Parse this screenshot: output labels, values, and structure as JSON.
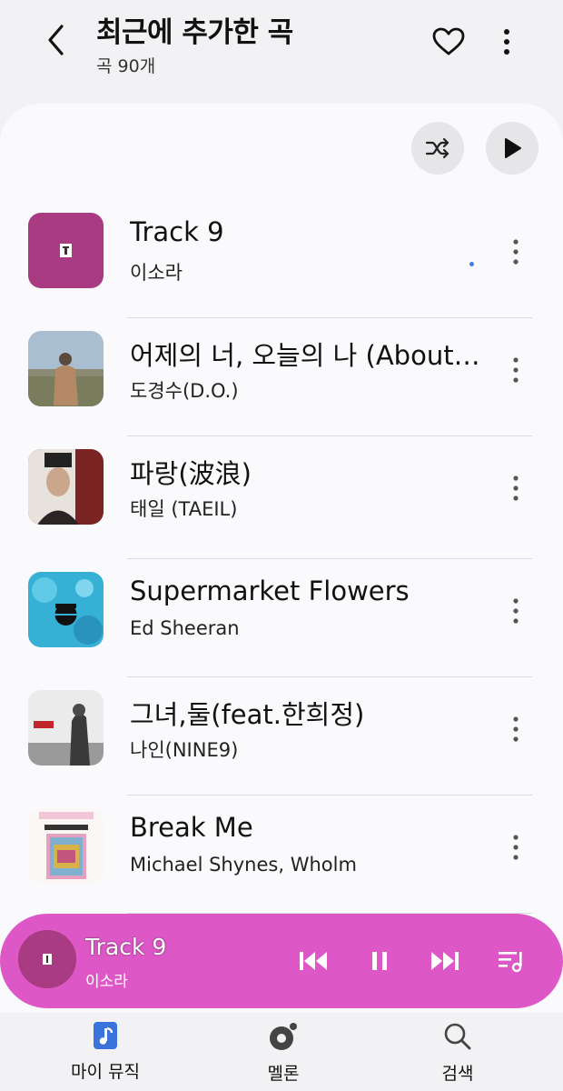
{
  "header": {
    "title": "최근에 추가한 곡",
    "subtitle": "곡 90개"
  },
  "tracks": [
    {
      "title": "Track 9",
      "artist": "이소라",
      "playing": true,
      "art_color": "#a83b82"
    },
    {
      "title": "어제의 너, 오늘의 나 (About…",
      "artist": "도경수(D.O.)",
      "playing": false,
      "art_color": "#9bb1c3"
    },
    {
      "title": "파랑(波浪)",
      "artist": "태일 (TAEIL)",
      "playing": false,
      "art_color": "#8a2f2f"
    },
    {
      "title": "Supermarket Flowers",
      "artist": "Ed Sheeran",
      "playing": false,
      "art_color": "#37b0d6"
    },
    {
      "title": "그녀,둘(feat.한희정)",
      "artist": "나인(NINE9)",
      "playing": false,
      "art_color": "#e9e9e9"
    },
    {
      "title": "Break Me",
      "artist": "Michael Shynes, Wholm",
      "playing": false,
      "art_color": "#f1c6d8"
    }
  ],
  "mini_player": {
    "title": "Track 9",
    "artist": "이소라",
    "background": "#dd58c6"
  },
  "bottom_nav": [
    {
      "label": "마이 뮤직",
      "icon": "music-note-icon",
      "active": true
    },
    {
      "label": "멜론",
      "icon": "melon-icon",
      "active": false
    },
    {
      "label": "검색",
      "icon": "search-icon",
      "active": false
    }
  ],
  "colors": {
    "accent_blue": "#3f7ee0",
    "player_pink": "#dd58c6"
  }
}
